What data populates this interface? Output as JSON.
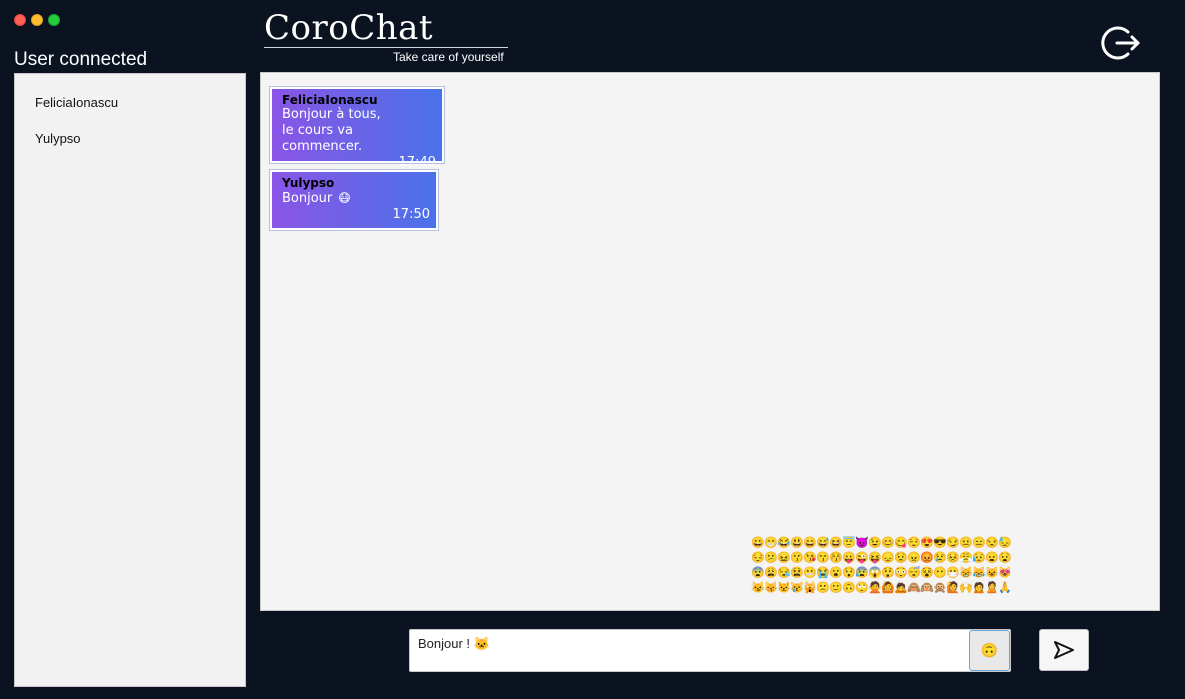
{
  "window": {
    "controls": [
      "close",
      "minimize",
      "maximize"
    ]
  },
  "sidebar": {
    "title": "User connected",
    "users": [
      "FeliciaIonascu",
      "Yulypso"
    ]
  },
  "header": {
    "brand": "CoroChat",
    "tagline": "Take care of yourself",
    "logout_icon": "logout-icon"
  },
  "messages": [
    {
      "author": "FeliciaIonascu",
      "text": "Bonjour à tous,\nle cours va commencer.",
      "time": "17:49"
    },
    {
      "author": "Yulypso",
      "text": "Bonjour",
      "time": "17:50",
      "emoji": "😷"
    }
  ],
  "emoji_picker": {
    "emojis": [
      "😀",
      "😁",
      "😂",
      "😃",
      "😄",
      "😅",
      "😆",
      "😇",
      "😈",
      "😉",
      "😊",
      "😋",
      "😌",
      "😍",
      "😎",
      "😏",
      "😐",
      "😑",
      "😒",
      "😓",
      "😔",
      "😕",
      "😖",
      "😗",
      "😘",
      "😙",
      "😚",
      "😛",
      "😜",
      "😝",
      "😞",
      "😟",
      "😠",
      "😡",
      "😢",
      "😣",
      "😤",
      "😥",
      "😦",
      "😧",
      "😨",
      "😩",
      "😪",
      "😫",
      "😬",
      "😭",
      "😮",
      "😯",
      "😰",
      "😱",
      "😲",
      "😳",
      "😴",
      "😵",
      "😶",
      "😷",
      "😸",
      "😹",
      "😺",
      "😻",
      "😼",
      "😽",
      "😾",
      "😿",
      "🙀",
      "🙁",
      "🙂",
      "🙃",
      "🙄",
      "🙅",
      "🙆",
      "🙇",
      "🙈",
      "🙉",
      "🙊",
      "🙋",
      "🙌",
      "🙍",
      "🙎",
      "🙏"
    ]
  },
  "composer": {
    "value": "Bonjour ! 🐱",
    "emoji_button": "🙃",
    "send_icon": "send-icon"
  },
  "colors": {
    "background": "#0b1220",
    "bubble_start": "#8a55e6",
    "bubble_end": "#4a72e8"
  }
}
